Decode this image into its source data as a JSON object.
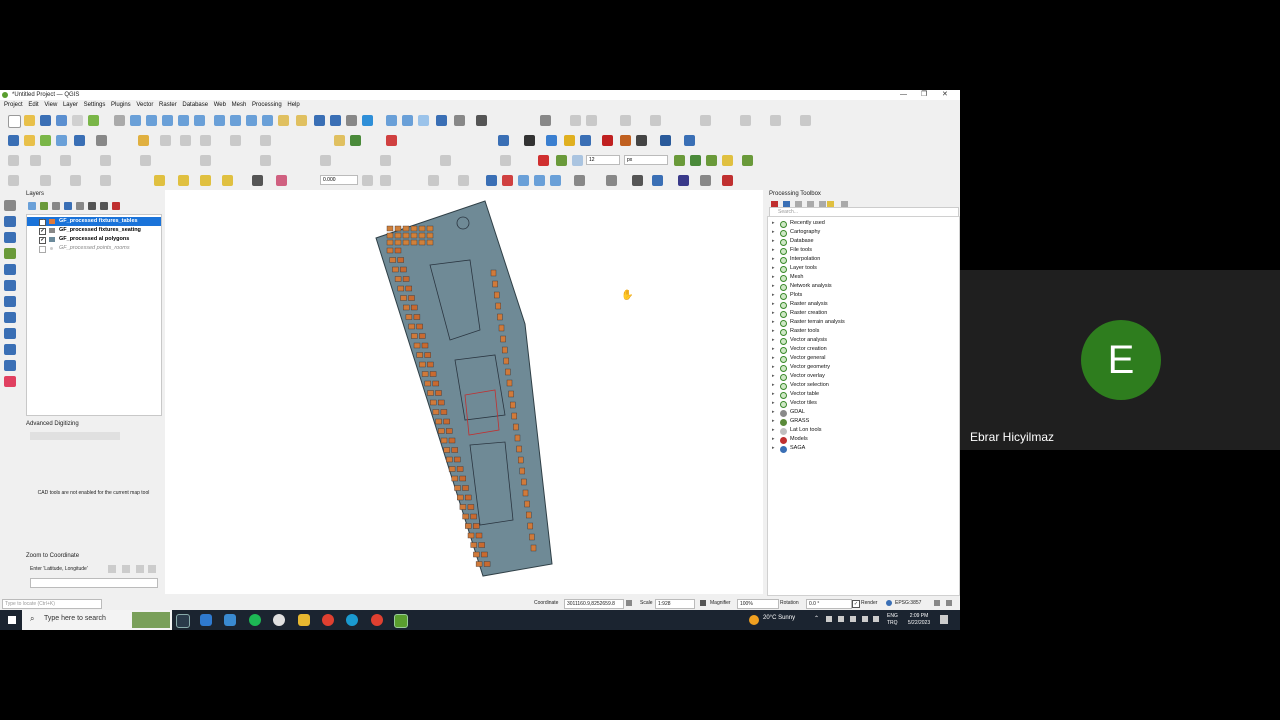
{
  "window": {
    "title": "*Untitled Project — QGIS",
    "controls": [
      "—",
      "❐",
      "✕"
    ]
  },
  "menu": [
    "Project",
    "Edit",
    "View",
    "Layer",
    "Settings",
    "Plugins",
    "Vector",
    "Raster",
    "Database",
    "Web",
    "Mesh",
    "Processing",
    "Help"
  ],
  "toolbar": {
    "snap_value": "12",
    "snap_unit": "px",
    "opacity_value": "0.000"
  },
  "layers_panel": {
    "title": "Layers",
    "layers": [
      {
        "name": "GF_processed fixtures_tables",
        "checked": true,
        "selected": true,
        "bold": true,
        "swatch": "#e07a3a"
      },
      {
        "name": "GF_processed fixtures_seating",
        "checked": true,
        "selected": false,
        "bold": true,
        "swatch": "#888888"
      },
      {
        "name": "GF_processed al polygons",
        "checked": true,
        "selected": false,
        "bold": true,
        "swatch": "#6b8a9b"
      },
      {
        "name": "GF_processed points_rooms",
        "checked": false,
        "selected": false,
        "bold": false,
        "swatch": "#cccccc"
      }
    ]
  },
  "advanced_digitizing": {
    "title": "Advanced Digitizing",
    "message": "CAD tools are not enabled for the current map tool"
  },
  "zoom_to_coordinate": {
    "title": "Zoom to Coordinate",
    "label": "Enter 'Latitude, Longitude'"
  },
  "processing_toolbox": {
    "title": "Processing Toolbox",
    "search_placeholder": "Search...",
    "items": [
      "Recently used",
      "Cartography",
      "Database",
      "File tools",
      "Interpolation",
      "Layer tools",
      "Mesh",
      "Network analysis",
      "Plots",
      "Raster analysis",
      "Raster creation",
      "Raster terrain analysis",
      "Raster tools",
      "Vector analysis",
      "Vector creation",
      "Vector general",
      "Vector geometry",
      "Vector overlay",
      "Vector selection",
      "Vector table",
      "Vector tiles",
      "GDAL",
      "GRASS",
      "Lat Lon tools",
      "Models",
      "SAGA"
    ]
  },
  "statusbar": {
    "locate_placeholder": "Type to locate (Ctrl+K)",
    "coordinate_label": "Coordinate",
    "coordinate_value": "3011160.9,8252659.8",
    "scale_label": "Scale",
    "scale_value": "1:928",
    "magnifier_label": "Magnifier",
    "magnifier_value": "100%",
    "rotation_label": "Rotation",
    "rotation_value": "0.0 °",
    "render_label": "Render",
    "crs": "EPSG:3857"
  },
  "taskbar": {
    "search_placeholder": "Type here to search",
    "weather": "20°C Sunny",
    "lang_line1": "ENG",
    "lang_line2": "TRQ",
    "time": "2:09 PM",
    "date": "5/22/2023"
  },
  "participant": {
    "initial": "E",
    "name": "Ebrar Hicyilmaz",
    "avatar_color": "#2e7d1e"
  }
}
